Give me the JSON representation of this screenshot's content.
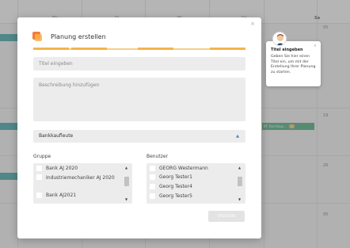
{
  "calendar": {
    "days": [
      "Mo",
      "Di",
      "Mi",
      "Do",
      "Fr",
      "Sa"
    ],
    "dates": [
      "05",
      "19",
      "26",
      "05"
    ],
    "event_label": "KT: Rechtspa...",
    "event_badge": "1"
  },
  "modal": {
    "title": "Planung erstellen",
    "close_icon": "×",
    "title_placeholder": "Titel eingeben",
    "description_placeholder": "Beschreibung hinzufügen",
    "selector_value": "Bankkaufleute",
    "selector_icon": "▲",
    "group_label": "Gruppe",
    "user_label": "Benutzer",
    "groups": [
      "Bank AJ 2020",
      "Industriemechaniker AJ 2020",
      "Bank AJ2021"
    ],
    "users": [
      "GEORG Westermann",
      "Georg Tester1",
      "Georg Tester4",
      "Georg Tester5"
    ],
    "scroll_up": "▲",
    "scroll_down": "▼",
    "save_label": "SPEICHERN"
  },
  "tooltip": {
    "title": "Titel eingeben",
    "body": "Geben Sie hier einen Titel ein, um mit der Erstellung Ihrer Planung zu starten.",
    "close_icon": "×"
  },
  "colors": {
    "accent": "#f6b44b",
    "selector_chevron": "#2a8ebd",
    "event": "#2ea36b",
    "teal": "#1f9a9d"
  }
}
